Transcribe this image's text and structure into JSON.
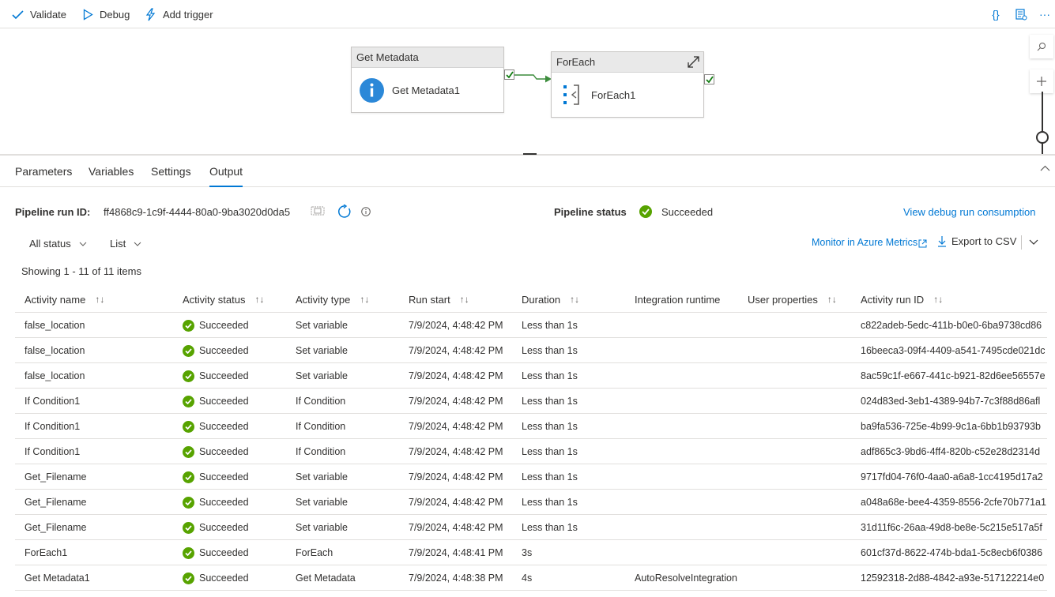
{
  "toolbar": {
    "validate_label": "Validate",
    "debug_label": "Debug",
    "add_trigger_label": "Add trigger",
    "code_icon_text": "{}",
    "more_icon_text": "···"
  },
  "canvas": {
    "node1": {
      "type_label": "Get Metadata",
      "name": "Get Metadata1"
    },
    "node2": {
      "type_label": "ForEach",
      "name": "ForEach1"
    }
  },
  "tabs": [
    "Parameters",
    "Variables",
    "Settings",
    "Output"
  ],
  "active_tab": "Output",
  "run": {
    "run_id_label": "Pipeline run ID:",
    "run_id": "ff4868c9-1c9f-4444-80a0-9ba3020d0da5",
    "status_label": "Pipeline status",
    "status": "Succeeded",
    "view_consumption": "View debug run consumption",
    "monitor_link": "Monitor in Azure Metrics",
    "export_label": "Export to CSV"
  },
  "filters": {
    "status_filter": "All status",
    "view_mode": "List"
  },
  "showing": "Showing 1 - 11 of 11 items",
  "columns": [
    "Activity name",
    "Activity status",
    "Activity type",
    "Run start",
    "Duration",
    "Integration runtime",
    "User properties",
    "Activity run ID"
  ],
  "rows": [
    {
      "name": "false_location",
      "status": "Succeeded",
      "type": "Set variable",
      "start": "7/9/2024, 4:48:42 PM",
      "duration": "Less than 1s",
      "runtime": "",
      "props": "",
      "run_id": "c822adeb-5edc-411b-b0e0-6ba9738cd86"
    },
    {
      "name": "false_location",
      "status": "Succeeded",
      "type": "Set variable",
      "start": "7/9/2024, 4:48:42 PM",
      "duration": "Less than 1s",
      "runtime": "",
      "props": "",
      "run_id": "16beeca3-09f4-4409-a541-7495cde021dc"
    },
    {
      "name": "false_location",
      "status": "Succeeded",
      "type": "Set variable",
      "start": "7/9/2024, 4:48:42 PM",
      "duration": "Less than 1s",
      "runtime": "",
      "props": "",
      "run_id": "8ac59c1f-e667-441c-b921-82d6ee56557e"
    },
    {
      "name": "If Condition1",
      "status": "Succeeded",
      "type": "If Condition",
      "start": "7/9/2024, 4:48:42 PM",
      "duration": "Less than 1s",
      "runtime": "",
      "props": "",
      "run_id": "024d83ed-3eb1-4389-94b7-7c3f88d86afl"
    },
    {
      "name": "If Condition1",
      "status": "Succeeded",
      "type": "If Condition",
      "start": "7/9/2024, 4:48:42 PM",
      "duration": "Less than 1s",
      "runtime": "",
      "props": "",
      "run_id": "ba9fa536-725e-4b99-9c1a-6bb1b93793b"
    },
    {
      "name": "If Condition1",
      "status": "Succeeded",
      "type": "If Condition",
      "start": "7/9/2024, 4:48:42 PM",
      "duration": "Less than 1s",
      "runtime": "",
      "props": "",
      "run_id": "adf865c3-9bd6-4ff4-820b-c52e28d2314d"
    },
    {
      "name": "Get_Filename",
      "status": "Succeeded",
      "type": "Set variable",
      "start": "7/9/2024, 4:48:42 PM",
      "duration": "Less than 1s",
      "runtime": "",
      "props": "",
      "run_id": "9717fd04-76f0-4aa0-a6a8-1cc4195d17a2"
    },
    {
      "name": "Get_Filename",
      "status": "Succeeded",
      "type": "Set variable",
      "start": "7/9/2024, 4:48:42 PM",
      "duration": "Less than 1s",
      "runtime": "",
      "props": "",
      "run_id": "a048a68e-bee4-4359-8556-2cfe70b771a1"
    },
    {
      "name": "Get_Filename",
      "status": "Succeeded",
      "type": "Set variable",
      "start": "7/9/2024, 4:48:42 PM",
      "duration": "Less than 1s",
      "runtime": "",
      "props": "",
      "run_id": "31d11f6c-26aa-49d8-be8e-5c215e517a5f"
    },
    {
      "name": "ForEach1",
      "status": "Succeeded",
      "type": "ForEach",
      "start": "7/9/2024, 4:48:41 PM",
      "duration": "3s",
      "runtime": "",
      "props": "",
      "run_id": "601cf37d-8622-474b-bda1-5c8ecb6f0386"
    },
    {
      "name": "Get Metadata1",
      "status": "Succeeded",
      "type": "Get Metadata",
      "start": "7/9/2024, 4:48:38 PM",
      "duration": "4s",
      "runtime": "AutoResolveIntegrationRuntime",
      "props": "",
      "run_id": "12592318-2d88-4842-a93e-517122214e0"
    }
  ],
  "colors": {
    "accent": "#0078d4",
    "success": "#57a300",
    "arrow": "#3c8c3c"
  }
}
